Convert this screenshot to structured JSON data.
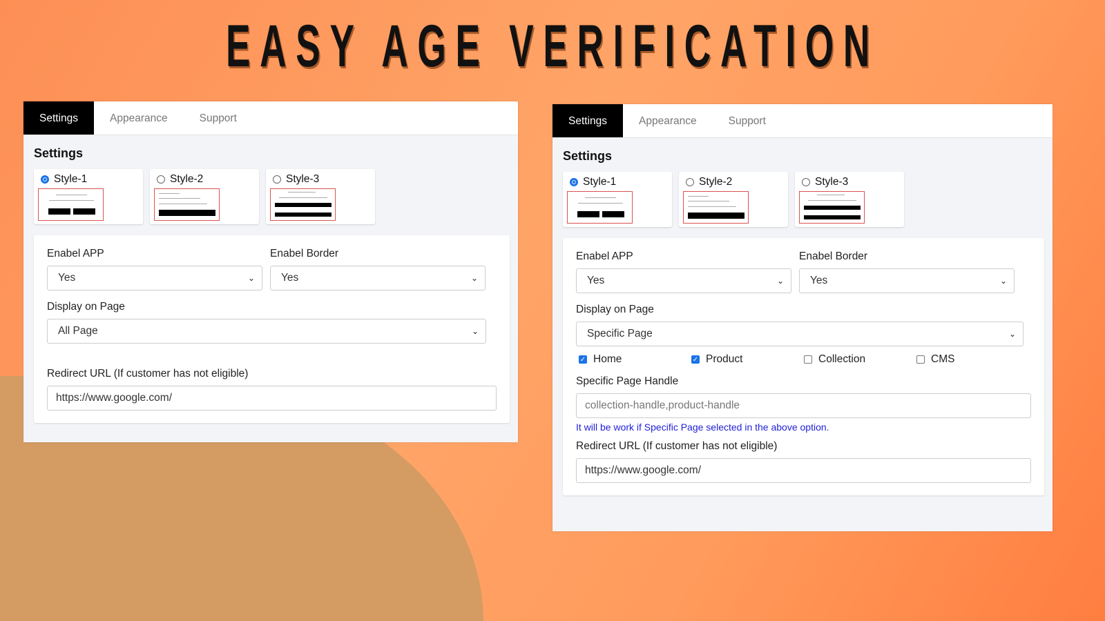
{
  "title": "EASY AGE VERIFICATION",
  "colors": {
    "accent": "#1a73e8",
    "help_text": "#1f1fd6",
    "thumb_border": "#d9534f"
  },
  "panels": [
    {
      "tabs": [
        "Settings",
        "Appearance",
        "Support"
      ],
      "active_tab": 0,
      "heading": "Settings",
      "styles": [
        {
          "label": "Style-1",
          "selected": true
        },
        {
          "label": "Style-2",
          "selected": false
        },
        {
          "label": "Style-3",
          "selected": false
        }
      ],
      "enable_app": {
        "label": "Enabel APP",
        "value": "Yes"
      },
      "enable_border": {
        "label": "Enabel Border",
        "value": "Yes"
      },
      "display": {
        "label": "Display on Page",
        "value": "All Page"
      },
      "redirect": {
        "label": "Redirect URL (If customer has not eligible)",
        "value": "https://www.google.com/"
      }
    },
    {
      "tabs": [
        "Settings",
        "Appearance",
        "Support"
      ],
      "active_tab": 0,
      "heading": "Settings",
      "styles": [
        {
          "label": "Style-1",
          "selected": true
        },
        {
          "label": "Style-2",
          "selected": false
        },
        {
          "label": "Style-3",
          "selected": false
        }
      ],
      "enable_app": {
        "label": "Enabel APP",
        "value": "Yes"
      },
      "enable_border": {
        "label": "Enabel Border",
        "value": "Yes"
      },
      "display": {
        "label": "Display on Page",
        "value": "Specific Page"
      },
      "pages": [
        {
          "label": "Home",
          "checked": true
        },
        {
          "label": "Product",
          "checked": true
        },
        {
          "label": "Collection",
          "checked": false
        },
        {
          "label": "CMS",
          "checked": false
        }
      ],
      "handle": {
        "label": "Specific Page Handle",
        "placeholder": "collection-handle,product-handle",
        "help": "It will be work if Specific Page selected in the above option."
      },
      "redirect": {
        "label": "Redirect URL (If customer has not eligible)",
        "value": "https://www.google.com/"
      }
    }
  ]
}
